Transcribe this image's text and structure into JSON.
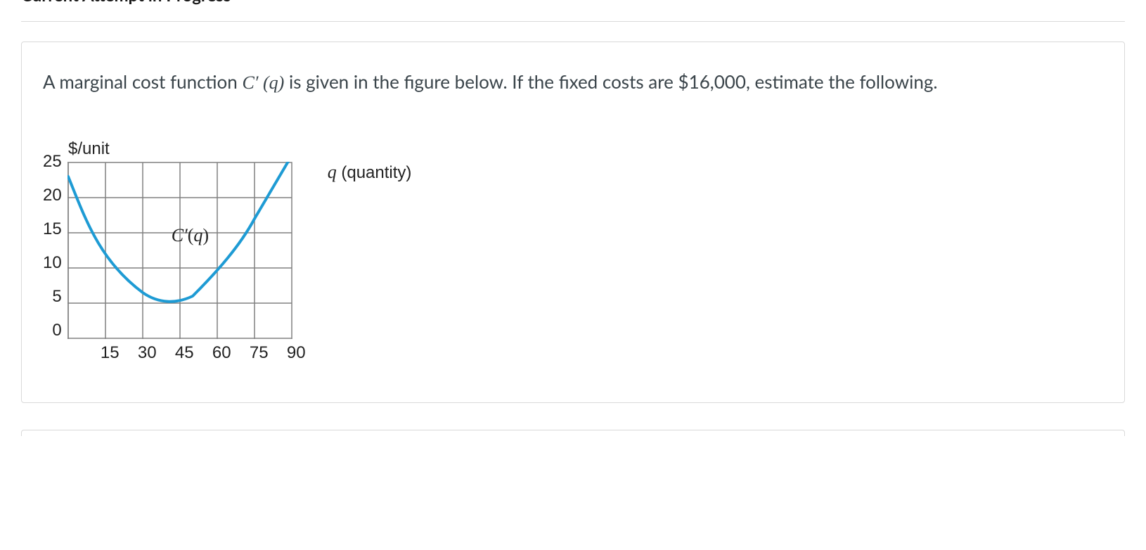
{
  "header": {
    "title": "Current Attempt in Progress"
  },
  "question": {
    "prefix": "A marginal cost function ",
    "func_C": "C",
    "func_prime": "′",
    "func_open": " (",
    "func_var": "q",
    "func_close": ")",
    "mid": " is given in the figure below. If the fixed costs are ",
    "cost": "$16,000",
    "suffix": ", estimate the following."
  },
  "chart_data": {
    "type": "line",
    "title": "",
    "ylabel": "$/unit",
    "xlabel_var": "q",
    "xlabel_rest": " (quantity)",
    "curve_label_C": "C",
    "curve_label_prime": "′",
    "curve_label_open": "(",
    "curve_label_var": "q",
    "curve_label_close": ")",
    "x_ticks": [
      "15",
      "30",
      "45",
      "60",
      "75",
      "90"
    ],
    "y_ticks": [
      "25",
      "20",
      "15",
      "10",
      "5",
      "0"
    ],
    "xlim": [
      0,
      90
    ],
    "ylim": [
      0,
      25
    ],
    "series": [
      {
        "name": "C'(q)",
        "x": [
          0,
          15,
          30,
          40,
          50,
          60,
          75,
          90
        ],
        "y": [
          23,
          12.5,
          6.5,
          5,
          6,
          9.5,
          17,
          26
        ]
      }
    ]
  }
}
